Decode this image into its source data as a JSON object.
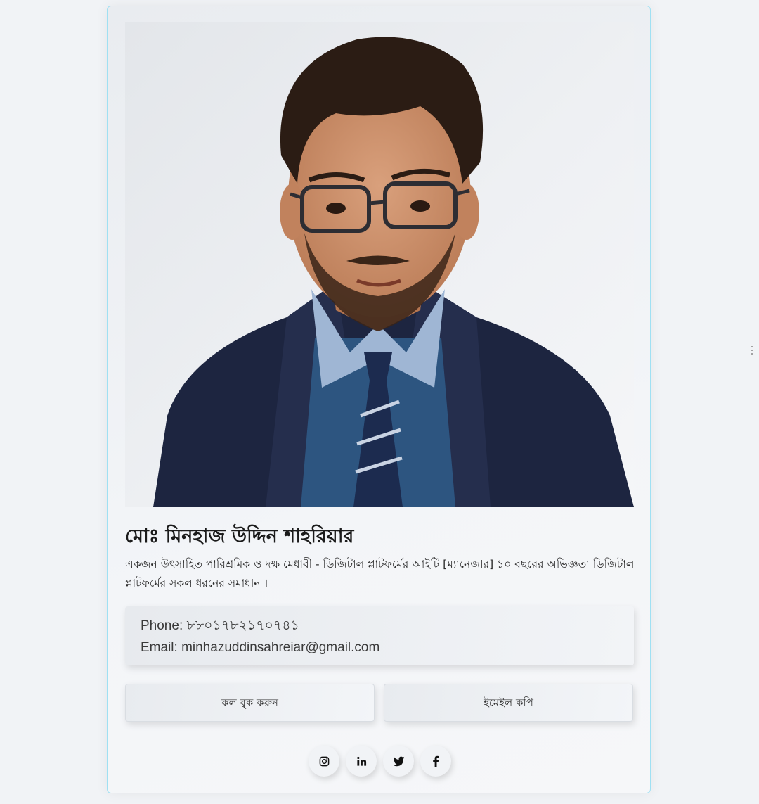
{
  "profile": {
    "name": "মোঃ মিনহাজ উদ্দিন শাহরিয়ার",
    "bio": "একজন উৎসাহিত পারিশ্রমিক ও দক্ষ মেধাবী - ডিজিটাল প্লাটফর্মের আইটি [ম্যানেজার] ১০ বছরের অভিজ্ঞতা ডিজিটাল প্লাটফর্মের সকল ধরনের সমাধান ।"
  },
  "contact": {
    "phone_line": "Phone: ৮৮০১৭৮২১৭০৭৪১",
    "email_line": "Email: minhazuddinsahreiar@gmail.com"
  },
  "actions": {
    "book_call_label": "কল বুক করুন",
    "copy_email_label": "ইমেইল কপি"
  },
  "socials": [
    {
      "icon": "instagram-icon"
    },
    {
      "icon": "linkedin-icon"
    },
    {
      "icon": "twitter-icon"
    },
    {
      "icon": "facebook-icon"
    }
  ],
  "colors": {
    "card_border": "#9fe0f3",
    "background": "#f1f3f6"
  }
}
